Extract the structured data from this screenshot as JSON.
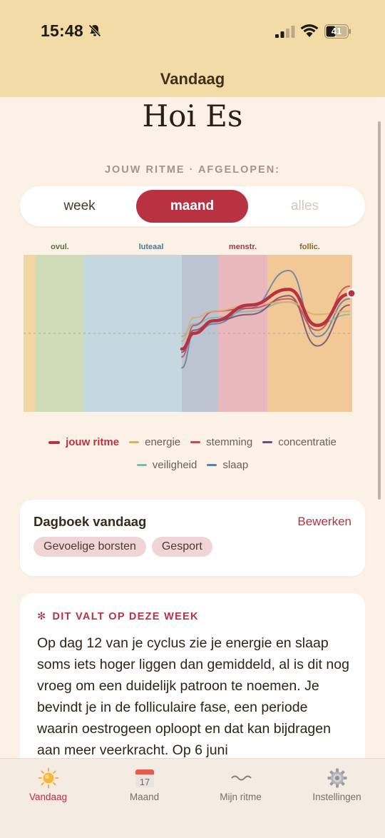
{
  "status_bar": {
    "time": "15:48",
    "battery_level": "41",
    "icons": [
      "bell-slash-icon",
      "signal-icon",
      "wifi-icon",
      "battery-icon"
    ]
  },
  "nav": {
    "title": "Vandaag"
  },
  "greeting": "Hoi Es",
  "rhythm_label": "JOUW RITME · AFGELOPEN:",
  "range_tabs": [
    {
      "label": "week",
      "selected": false
    },
    {
      "label": "maand",
      "selected": true
    },
    {
      "label": "alles",
      "selected": false
    }
  ],
  "colors": {
    "accent": "#b83242",
    "header": "#f3dba7",
    "background": "#fbf1e6"
  },
  "chart_data": {
    "type": "line",
    "phases": [
      {
        "name": "ovul.",
        "color": "#cfdcb8",
        "label_color": "#5f6e3c"
      },
      {
        "name": "luteaal",
        "color": "#c5d8e0",
        "label_color": "#4f7892"
      },
      {
        "name": "menstr.",
        "color": "#e8b8bd",
        "label_color": "#9a3a45"
      },
      {
        "name": "follic.",
        "color": "#f2c996",
        "label_color": "#946426"
      }
    ],
    "series": [
      {
        "name": "jouw ritme",
        "color": "#b83242",
        "values": [
          0.4,
          0.5,
          0.58,
          0.68,
          0.78,
          0.55,
          0.75
        ]
      },
      {
        "name": "energie",
        "color": "#d9ad6b",
        "values": [
          0.45,
          0.6,
          0.64,
          0.68,
          0.7,
          0.62,
          0.64
        ]
      },
      {
        "name": "stemming",
        "color": "#c24a55",
        "values": [
          0.35,
          0.55,
          0.64,
          0.66,
          0.72,
          0.52,
          0.8
        ]
      },
      {
        "name": "concentratie",
        "color": "#6f4e73",
        "values": [
          0.38,
          0.52,
          0.58,
          0.62,
          0.74,
          0.42,
          0.68
        ]
      },
      {
        "name": "veiligheid",
        "color": "#84b8a6",
        "values": [
          0.48,
          0.56,
          0.6,
          0.64,
          0.7,
          0.56,
          0.62
        ]
      },
      {
        "name": "slaap",
        "color": "#5e7fa8",
        "values": [
          0.28,
          0.5,
          0.56,
          0.66,
          0.9,
          0.48,
          0.72
        ]
      }
    ],
    "ylim": [
      0,
      1
    ],
    "grid": false
  },
  "legend": [
    {
      "label": "jouw ritme",
      "color": "#b83242"
    },
    {
      "label": "energie",
      "color": "#d9ad6b"
    },
    {
      "label": "stemming",
      "color": "#c24a55"
    },
    {
      "label": "concentratie",
      "color": "#6f4e73"
    },
    {
      "label": "veiligheid",
      "color": "#84b8a6"
    },
    {
      "label": "slaap",
      "color": "#5e7fa8"
    }
  ],
  "journal": {
    "title": "Dagboek vandaag",
    "edit_label": "Bewerken",
    "tags": [
      "Gevoelige borsten",
      "Gesport"
    ]
  },
  "insight": {
    "title": "DIT VALT OP DEZE WEEK",
    "body": "Op dag 12 van je cyclus zie je energie en slaap soms iets hoger liggen dan gemiddeld, al is dit nog vroeg om een duidelijk patroon te noemen. Je bevindt je in de folliculaire fase, een periode waarin oestrogeen oploopt en dat kan bijdragen aan meer veerkracht. Op 6 juni"
  },
  "tabs": [
    {
      "label": "Vandaag",
      "icon": "sun-icon",
      "active": true
    },
    {
      "label": "Maand",
      "icon": "calendar-icon",
      "active": false,
      "icon_text": "17"
    },
    {
      "label": "Mijn ritme",
      "icon": "wave-icon",
      "active": false
    },
    {
      "label": "Instellingen",
      "icon": "gear-icon",
      "active": false
    }
  ]
}
